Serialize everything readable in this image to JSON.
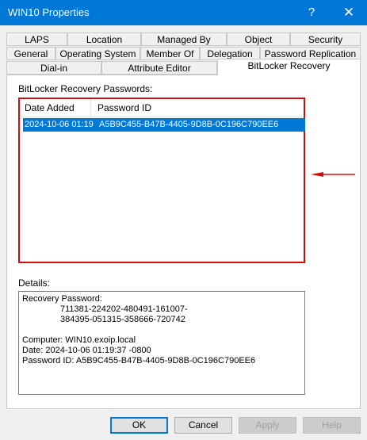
{
  "window": {
    "title": "WIN10 Properties",
    "help_glyph": "?",
    "close_glyph": "✕"
  },
  "tabs": {
    "row1": [
      "LAPS",
      "Location",
      "Managed By",
      "Object",
      "Security"
    ],
    "row2": [
      "General",
      "Operating System",
      "Member Of",
      "Delegation",
      "Password Replication"
    ],
    "row3": [
      "Dial-in",
      "Attribute Editor",
      "BitLocker Recovery"
    ],
    "active": "BitLocker Recovery"
  },
  "recovery": {
    "label": "BitLocker Recovery Passwords:",
    "columns": [
      "Date Added",
      "Password ID"
    ],
    "rows": [
      {
        "date": "2024-10-06 01:19",
        "password_id": "A5B9C455-B47B-4405-9D8B-0C196C790EE6",
        "selected": true
      }
    ]
  },
  "details": {
    "label": "Details:",
    "recovery_password_label": "Recovery Password:",
    "recovery_password_line1": "711381-224202-480491-161007-",
    "recovery_password_line2": "384395-051315-358666-720742",
    "computer": "Computer: WIN10.exoip.local",
    "date": "Date: 2024-10-06 01:19:37 -0800",
    "password_id": "Password ID: A5B9C455-B47B-4405-9D8B-0C196C790EE6"
  },
  "buttons": {
    "ok": "OK",
    "cancel": "Cancel",
    "apply": "Apply",
    "help": "Help"
  },
  "colors": {
    "titlebar": "#0078d7",
    "highlight": "#d01010",
    "selection": "#0078d7"
  }
}
